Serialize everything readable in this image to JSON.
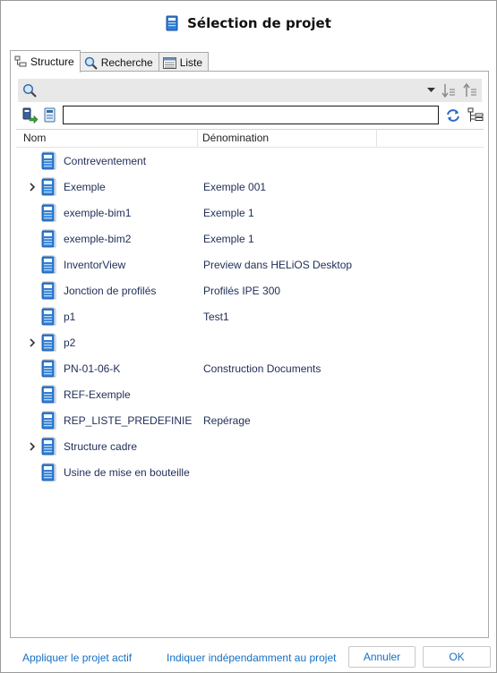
{
  "window": {
    "title": "Sélection de projet"
  },
  "tabs": [
    {
      "label": "Structure",
      "icon": "tree-structure-icon",
      "active": true
    },
    {
      "label": "Recherche",
      "icon": "magnifier-icon",
      "active": false
    },
    {
      "label": "Liste",
      "icon": "list-window-icon",
      "active": false
    }
  ],
  "filter": {
    "value": ""
  },
  "grid": {
    "columns": [
      "Nom",
      "Dénomination"
    ],
    "rows": [
      {
        "name": "Contreventement",
        "denomination": "",
        "expandable": false
      },
      {
        "name": "Exemple",
        "denomination": "Exemple 001",
        "expandable": true
      },
      {
        "name": "exemple-bim1",
        "denomination": "Exemple 1",
        "expandable": false
      },
      {
        "name": "exemple-bim2",
        "denomination": "Exemple 1",
        "expandable": false
      },
      {
        "name": "InventorView",
        "denomination": "Preview dans HELiOS Desktop",
        "expandable": false
      },
      {
        "name": "Jonction de profilés",
        "denomination": "Profilés IPE 300",
        "expandable": false
      },
      {
        "name": "p1",
        "denomination": "Test1",
        "expandable": false
      },
      {
        "name": "p2",
        "denomination": "",
        "expandable": true
      },
      {
        "name": "PN-01-06-K",
        "denomination": "Construction Documents",
        "expandable": false
      },
      {
        "name": "REF-Exemple",
        "denomination": "",
        "expandable": false
      },
      {
        "name": "REP_LISTE_PREDEFINIE",
        "denomination": "Repérage",
        "expandable": false
      },
      {
        "name": "Structure cadre",
        "denomination": "",
        "expandable": true
      },
      {
        "name": "Usine de mise en bouteille",
        "denomination": "",
        "expandable": false
      }
    ]
  },
  "footer": {
    "apply_active": "Appliquer le projet actif",
    "indicate_independent": "Indiquer indépendamment au projet",
    "cancel": "Annuler",
    "ok": "OK"
  },
  "colors": {
    "link": "#1570c4",
    "row_text": "#1f2d57",
    "project_icon": "#2f7fd8"
  }
}
